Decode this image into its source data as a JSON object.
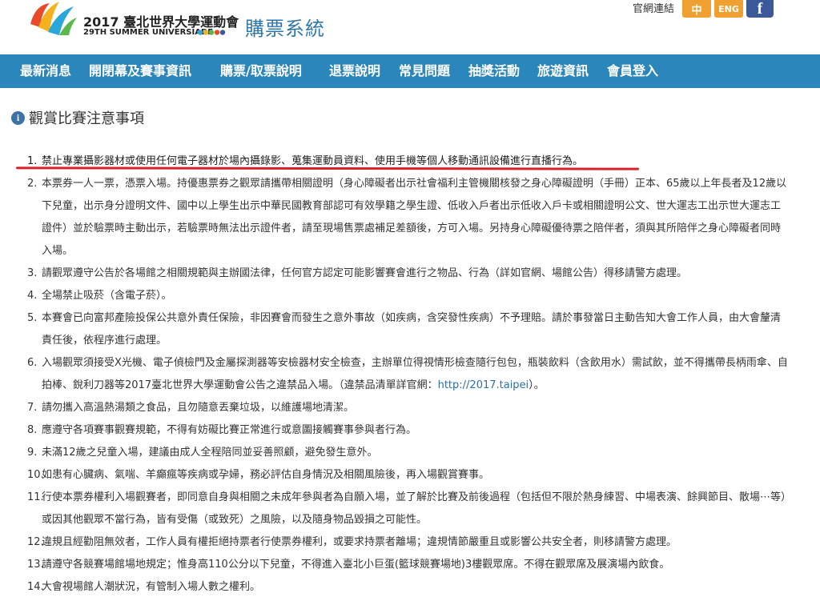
{
  "header": {
    "logo_title": "2017 臺北世界大學運動會",
    "logo_sub": "29TH SUMMER UNIVERSIADE",
    "system_title": "購票系統",
    "official_link": "官網連結",
    "lang_zh": "中",
    "lang_en": "ENG",
    "facebook_glyph": "f"
  },
  "nav": {
    "items": [
      {
        "label": "最新消息"
      },
      {
        "label": "開閉幕及賽事資訊"
      },
      {
        "label": "購票/取票說明"
      },
      {
        "label": "退票說明"
      },
      {
        "label": "常見問題"
      },
      {
        "label": "抽獎活動"
      },
      {
        "label": "旅遊資訊"
      },
      {
        "label": "會員登入"
      }
    ]
  },
  "section": {
    "heading": "觀賞比賽注意事項",
    "icon": "info-icon"
  },
  "notices": [
    {
      "num": "1.",
      "text": "禁止專業攝影器材或使用任何電子器材於場內攝錄影、蒐集運動員資料、使用手機等個人移動通訊設備進行直播行為。"
    },
    {
      "num": "2.",
      "text": "本票券一人一票，憑票入場。持優惠票券之觀眾請攜帶相關證明（身心障礙者出示社會福利主管機關核發之身心障礙證明（手冊）正本、65歲以上年長者及12歲以下兒童，出示身分證明文件、國中以上學生出示中華民國教育部認可有效學籍之學生證、低收入戶者出示低收入戶卡或相關證明公文、世大運志工出示世大運志工證件）並於驗票時主動出示，若驗票時無法出示證件者，請至現場售票處補足差額後，方可入場。另持身心障礙優待票之陪伴者，須與其所陪伴之身心障礙者同時入場。"
    },
    {
      "num": "3.",
      "text": "請觀眾遵守公告於各場館之相關規範與主辦國法律，任何官方認定可能影響賽會進行之物品、行為（詳如官網、場館公告）得移請警方處理。"
    },
    {
      "num": "4.",
      "text": "全場禁止吸菸（含電子菸）。"
    },
    {
      "num": "5.",
      "text": "本賽會已向富邦產險投保公共意外責任保險，非因賽會而發生之意外事故（如疾病，含突發性疾病）不予理賠。請於事發當日主動告知大會工作人員，由大會釐清責任後，依程序進行處理。"
    },
    {
      "num": "6.",
      "text": "入場觀眾須接受X光機、電子偵檢門及金屬探測器等安檢器材安全檢查，主辦單位得視情形檢查隨行包包，瓶裝飲料（含飲用水）需試飲，並不得攜帶長柄雨傘、自拍棒、銳利刀器等2017臺北世界大學運動會公告之違禁品入場。（違禁品清單詳官網：",
      "link": "http://2017.taipei",
      "after": "）。"
    },
    {
      "num": "7.",
      "text": "請勿攜入高溫熱湯類之食品，且勿隨意丟棄垃圾，以維護場地清潔。"
    },
    {
      "num": "8.",
      "text": "應遵守各項賽事觀賽規範，不得有妨礙比賽正常進行或意圖接觸賽事參與者行為。"
    },
    {
      "num": "9.",
      "text": "未滿12歲之兒童入場，建議由成人全程陪同並妥善照顧，避免發生意外。"
    },
    {
      "num": "10.",
      "text": "如患有心臟病、氣喘、羊癲瘋等疾病或孕婦，務必評估自身情況及相關風險後，再入場觀賞賽事。"
    },
    {
      "num": "11.",
      "text": "行使本票券權利入場觀賽者，即同意自身與相關之未成年參與者為自願入場，並了解於比賽及前後過程（包括但不限於熱身練習、中場表演、餘興節目、散場⋯等）或因其他觀眾不當行為，皆有受傷（或致死）之風險，以及隨身物品毀損之可能性。"
    },
    {
      "num": "12.",
      "text": "違規且經勸阻無效者，工作人員有權拒絕持票者行使票券權利，或要求持票者離場；違規情節嚴重且或影響公共安全者，則移請警方處理。"
    },
    {
      "num": "13.",
      "text": "請遵守各競賽場館場地規定；惟身高110公分以下兒童，不得進入臺北小巨蛋(籃球競賽場地)3樓觀眾席。不得在觀眾席及展演場內飲食。"
    },
    {
      "num": "14.",
      "text": "大會視場館人潮狀況，有管制入場人數之權利。"
    }
  ]
}
